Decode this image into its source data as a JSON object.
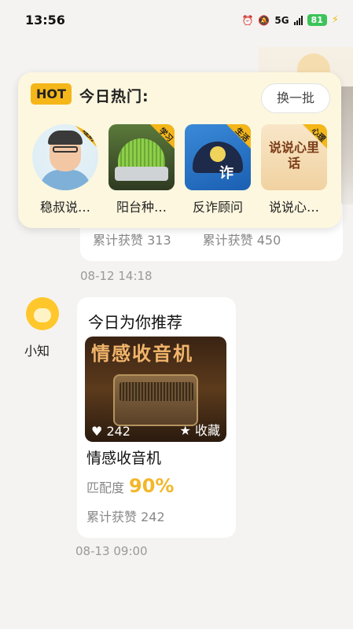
{
  "status_bar": {
    "time": "13:56",
    "network": "5G",
    "battery": "81"
  },
  "hot_panel": {
    "badge": "HOT",
    "title": "今日热门:",
    "refresh_label": "换一批",
    "items": [
      {
        "label": "稳叔说…",
        "tag": "理财"
      },
      {
        "label": "阳台种…",
        "tag": "学习"
      },
      {
        "label": "反诈顾问",
        "tag": "生活",
        "cover_text": "诈"
      },
      {
        "label": "说说心…",
        "tag": "心理",
        "cover_text": "说说心里话"
      }
    ]
  },
  "prev_card": {
    "stat_left": "累计获赞 313",
    "stat_right": "累计获赞 450",
    "time": "08-12 14:18"
  },
  "bot": {
    "name": "小知"
  },
  "rec_card": {
    "title": "今日为你推荐",
    "cover_title": "情感收音机",
    "likes_overlay": "242",
    "fav_label": "收藏",
    "name": "情感收音机",
    "match_label": "匹配度",
    "match_value": "90%",
    "total_likes": "累计获赞 242",
    "time": "08-13 09:00"
  },
  "colors": {
    "accent": "#f4b619",
    "panel_bg": "#fdf7df",
    "match": "#f2b72a"
  }
}
